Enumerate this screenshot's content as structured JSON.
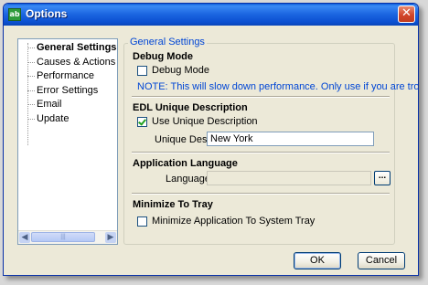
{
  "window": {
    "title": "Options",
    "icon": "app-icon",
    "close_glyph": "✕",
    "app_icon_glyph": "ab"
  },
  "tree": {
    "items": [
      {
        "label": "General Settings",
        "selected": true
      },
      {
        "label": "Causes & Actions"
      },
      {
        "label": "Performance"
      },
      {
        "label": "Error Settings"
      },
      {
        "label": "Email"
      },
      {
        "label": "Update"
      }
    ],
    "scroll_left": "◀",
    "scroll_right": "▶",
    "scroll_thumb": "|||"
  },
  "group_title": "General Settings",
  "debug": {
    "heading": "Debug Mode",
    "checkbox_label": "Debug Mode",
    "checked": false,
    "note": "NOTE: This will slow down performance. Only use if you are troubleshooting."
  },
  "edl": {
    "heading": "EDL Unique Description",
    "checkbox_label": "Use Unique Description",
    "checked": true,
    "desc_label": "Unique Desc:",
    "desc_value": "New York"
  },
  "language": {
    "heading": "Application Language",
    "label": "Language:",
    "value": "",
    "browse_label": "..."
  },
  "tray": {
    "heading": "Minimize To Tray",
    "checkbox_label": "Minimize Application To System Tray",
    "checked": false
  },
  "buttons": {
    "ok": "OK",
    "cancel": "Cancel"
  },
  "colors": {
    "accent": "#0046d5",
    "titlebar": "#1a64e0",
    "check": "#21a121"
  }
}
